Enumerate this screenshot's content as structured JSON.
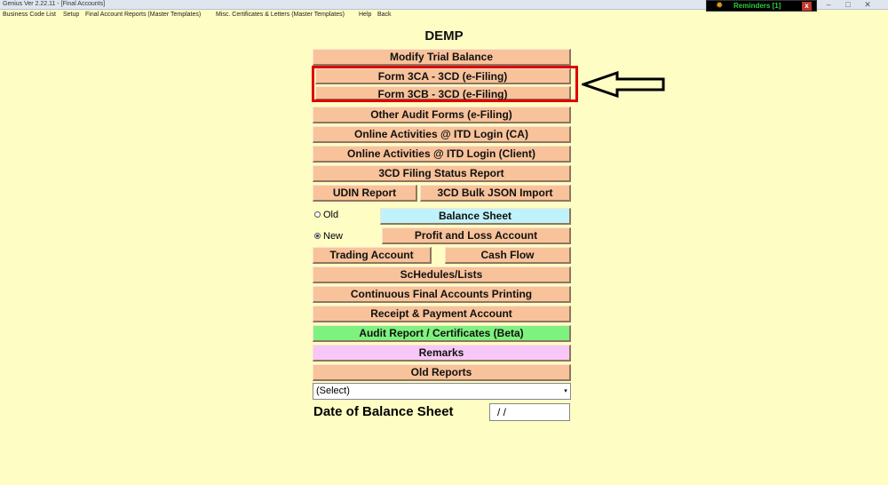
{
  "window": {
    "title": "Genius Ver 2.22.11 - [Final Accounts]",
    "reminders_label": "Reminders [1]",
    "close_glyph": "x"
  },
  "menu": {
    "items": [
      "Business Code List",
      "Setup",
      "Final Account Reports (Master Templates)",
      "Misc. Certificates & Letters (Master Templates)",
      "Help",
      "Back"
    ]
  },
  "heading": "DEMP",
  "buttons": {
    "modify_trial_balance": "Modify Trial Balance",
    "form_3ca": "Form 3CA - 3CD (e-Filing)",
    "form_3cb": "Form 3CB - 3CD (e-Filing)",
    "other_audit_forms": "Other Audit Forms (e-Filing)",
    "online_ca": "Online Activities @ ITD Login (CA)",
    "online_client": "Online Activities @ ITD Login (Client)",
    "filing_status": "3CD Filing Status Report",
    "udin_report": "UDIN Report",
    "bulk_json": "3CD Bulk JSON Import",
    "balance_sheet": "Balance Sheet",
    "profit_loss": "Profit and Loss Account",
    "trading_account": "Trading Account",
    "cash_flow": "Cash Flow",
    "schedules": "ScHedules/Lists",
    "continuous_printing": "Continuous Final Accounts Printing",
    "receipt_payment": "Receipt & Payment Account",
    "audit_report": "Audit Report / Certificates (Beta)",
    "remarks": "Remarks",
    "old_reports": "Old Reports"
  },
  "radios": {
    "old_label": "Old",
    "new_label": "New",
    "selected": "New"
  },
  "select": {
    "value": "(Select)"
  },
  "date": {
    "label": "Date of Balance Sheet",
    "value": "/ /"
  },
  "colors": {
    "background": "#fdfdc4",
    "button": "#f8c29a",
    "balance_sheet_button": "#bff3fb",
    "audit_button": "#7ef27e",
    "remarks_button": "#f7c8f7",
    "highlight_box": "#e00000"
  }
}
